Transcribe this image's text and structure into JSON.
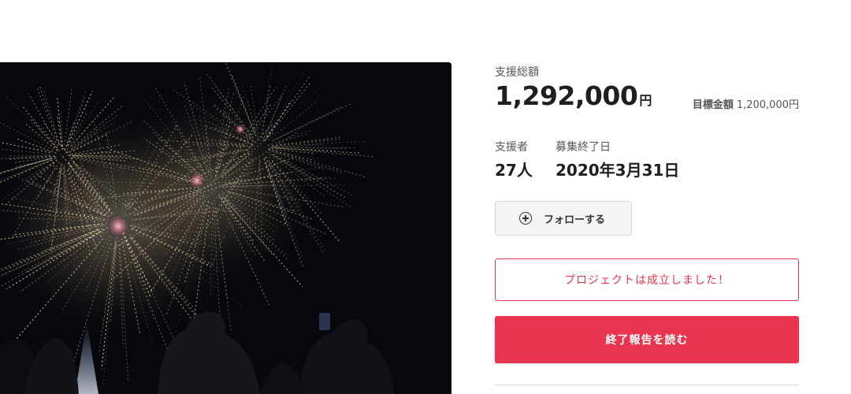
{
  "project": {
    "raised_label": "支援総額",
    "raised_amount": "1,292,000",
    "currency": "円",
    "goal_label": "目標金額",
    "goal_amount": "1,200,000円",
    "backers_label": "支援者",
    "backers_value": "27人",
    "end_date_label": "募集終了日",
    "end_date_value": "2020年3月31日"
  },
  "actions": {
    "follow_label": "フォローする",
    "success_message": "プロジェクトは成立しました！",
    "report_label": "終了報告を読む"
  },
  "icons": {
    "follow": "plus-circle-icon"
  },
  "colors": {
    "accent": "#e8344e",
    "hero_background": "#06080d"
  }
}
